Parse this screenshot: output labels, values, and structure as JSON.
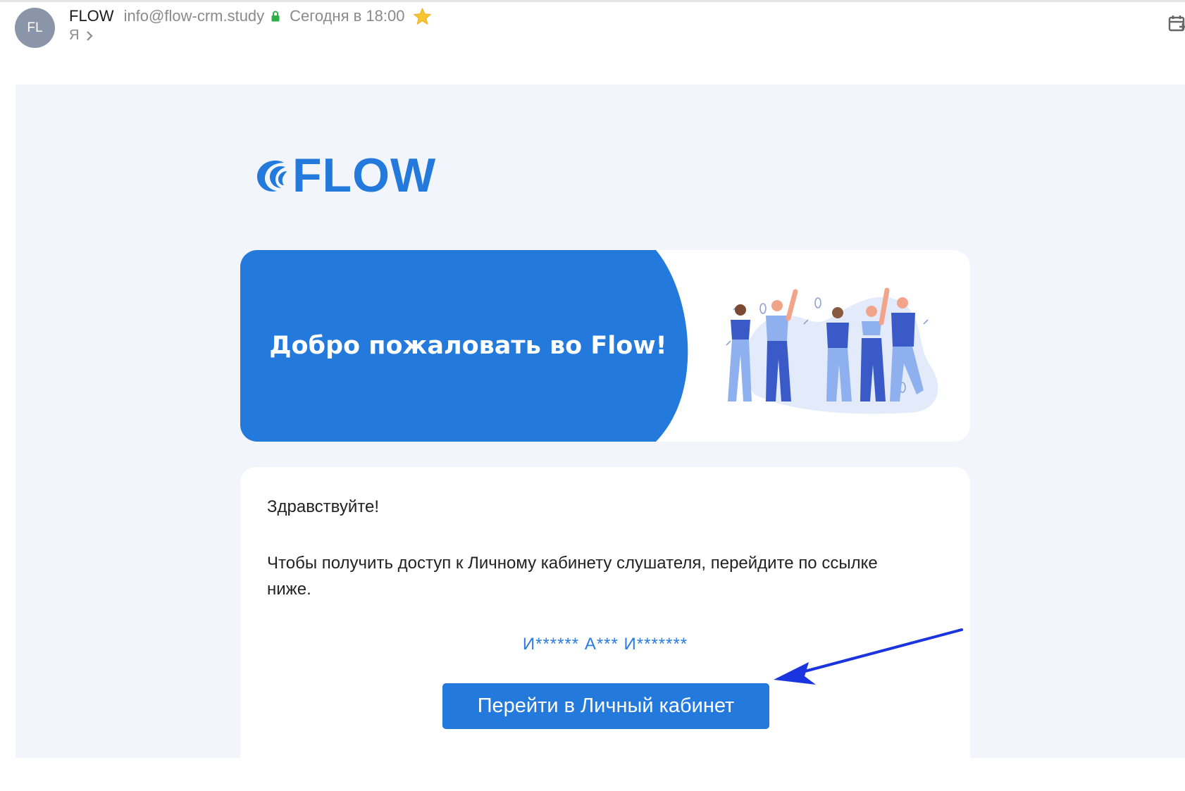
{
  "header": {
    "avatar_initials": "FL",
    "sender_name": "FLOW",
    "sender_email": "info@flow-crm.study",
    "sent_time": "Сегодня в 18:00",
    "recipient": "Я",
    "icons": [
      "lock-icon",
      "star-icon",
      "chevron-right-icon",
      "calendar-add-icon"
    ]
  },
  "email": {
    "logo_text": "FLOW",
    "banner_title": "Добро пожаловать во Flow!",
    "greeting": "Здравствуйте!",
    "body_text": "Чтобы получить доступ к Личному кабинету слушателя, перейдите по ссылке ниже.",
    "user_name": "И****** А*** И*******",
    "cta_label": "Перейти в Личный кабинет"
  },
  "colors": {
    "accent": "#2479dc",
    "background": "#f2f6fc",
    "annotation_arrow": "#1a34e0"
  }
}
